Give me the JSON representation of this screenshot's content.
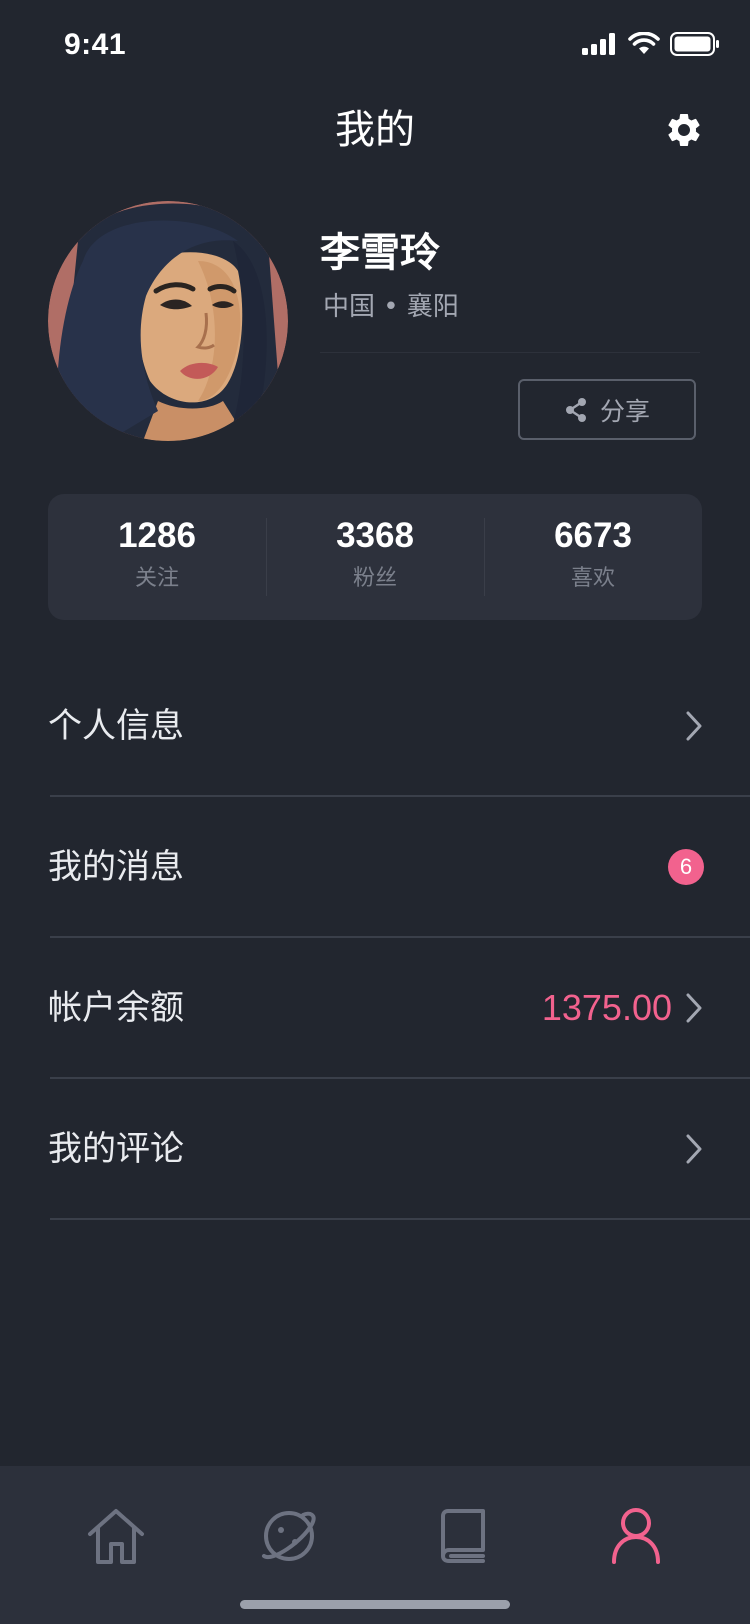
{
  "status_bar": {
    "time": "9:41"
  },
  "header": {
    "title": "我的"
  },
  "profile": {
    "name": "李雪玲",
    "location": "中国 • 襄阳",
    "share_label": "分享"
  },
  "stats": [
    {
      "value": "1286",
      "label": "关注"
    },
    {
      "value": "3368",
      "label": "粉丝"
    },
    {
      "value": "6673",
      "label": "喜欢"
    }
  ],
  "menu": [
    {
      "label": "个人信息"
    },
    {
      "label": "我的消息",
      "badge": "6"
    },
    {
      "label": "帐户余额",
      "value": "1375.00"
    },
    {
      "label": "我的评论"
    }
  ],
  "tabbar": {
    "items": [
      {
        "icon": "home-icon"
      },
      {
        "icon": "planet-icon"
      },
      {
        "icon": "book-icon"
      },
      {
        "icon": "user-icon",
        "active": true
      }
    ]
  },
  "colors": {
    "background": "#22262f",
    "card": "#2d313c",
    "accent": "#f2628e",
    "muted": "#a3a7b2"
  }
}
